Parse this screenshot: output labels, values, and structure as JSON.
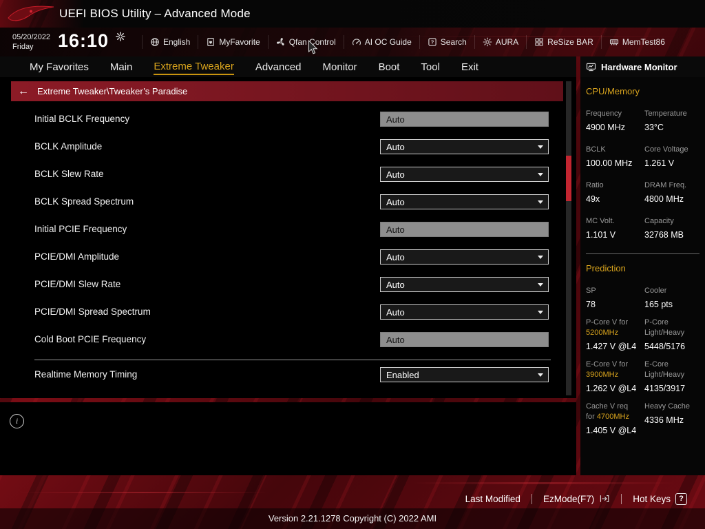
{
  "header": {
    "title": "UEFI BIOS Utility – Advanced Mode",
    "date": "05/20/2022",
    "day": "Friday",
    "time": "16:10",
    "toolbar": [
      {
        "icon": "globe-icon",
        "label": "English"
      },
      {
        "icon": "favorite-icon",
        "label": "MyFavorite"
      },
      {
        "icon": "fan-icon",
        "label": "Qfan Control"
      },
      {
        "icon": "gauge-icon",
        "label": "AI OC Guide"
      },
      {
        "icon": "question-icon",
        "label": "Search"
      },
      {
        "icon": "aura-icon",
        "label": "AURA"
      },
      {
        "icon": "grid-icon",
        "label": "ReSize BAR"
      },
      {
        "icon": "memory-icon",
        "label": "MemTest86"
      }
    ]
  },
  "menu": {
    "tabs": [
      "My Favorites",
      "Main",
      "Extreme Tweaker",
      "Advanced",
      "Monitor",
      "Boot",
      "Tool",
      "Exit"
    ],
    "active_tab": "Extreme Tweaker"
  },
  "breadcrumb": {
    "back_icon": "←",
    "path": "Extreme Tweaker\\Tweaker’s Paradise"
  },
  "settings": [
    {
      "label": "Initial BCLK Frequency",
      "value": "Auto",
      "control": "input"
    },
    {
      "label": "BCLK Amplitude",
      "value": "Auto",
      "control": "select"
    },
    {
      "label": "BCLK Slew Rate",
      "value": "Auto",
      "control": "select"
    },
    {
      "label": "BCLK Spread Spectrum",
      "value": "Auto",
      "control": "select"
    },
    {
      "label": "Initial PCIE Frequency",
      "value": "Auto",
      "control": "input"
    },
    {
      "label": "PCIE/DMI Amplitude",
      "value": "Auto",
      "control": "select"
    },
    {
      "label": "PCIE/DMI Slew Rate",
      "value": "Auto",
      "control": "select"
    },
    {
      "label": "PCIE/DMI Spread Spectrum",
      "value": "Auto",
      "control": "select"
    },
    {
      "label": "Cold Boot PCIE Frequency",
      "value": "Auto",
      "control": "input"
    },
    {
      "control": "divider"
    },
    {
      "label": "Realtime Memory Timing",
      "value": "Enabled",
      "control": "select"
    }
  ],
  "hardware_monitor": {
    "title": "Hardware Monitor",
    "sections": [
      {
        "title": "CPU/Memory",
        "divider_after": true,
        "cells": [
          {
            "lines": [
              "Frequency"
            ],
            "value": "4900 MHz"
          },
          {
            "lines": [
              "Temperature"
            ],
            "value": "33°C"
          },
          {
            "lines": [
              "BCLK"
            ],
            "value": "100.00 MHz"
          },
          {
            "lines": [
              "Core Voltage"
            ],
            "value": "1.261 V"
          },
          {
            "lines": [
              "Ratio"
            ],
            "value": "49x"
          },
          {
            "lines": [
              "DRAM Freq."
            ],
            "value": "4800 MHz"
          },
          {
            "lines": [
              "MC Volt."
            ],
            "value": "1.101 V"
          },
          {
            "lines": [
              "Capacity"
            ],
            "value": "32768 MB"
          }
        ]
      },
      {
        "title": "Prediction",
        "divider_after": false,
        "cells": [
          {
            "lines": [
              "SP"
            ],
            "value": "78"
          },
          {
            "lines": [
              "Cooler"
            ],
            "value": "165 pts"
          },
          {
            "lines": [
              "P-Core V for",
              {
                "accent": "5200MHz"
              }
            ],
            "value": "1.427 V @L4"
          },
          {
            "lines": [
              "P-Core",
              "Light/Heavy"
            ],
            "value": "5448/5176"
          },
          {
            "lines": [
              "E-Core V for",
              {
                "accent": "3900MHz"
              }
            ],
            "value": "1.262 V @L4"
          },
          {
            "lines": [
              "E-Core",
              "Light/Heavy"
            ],
            "value": "4135/3917"
          },
          {
            "lines": [
              "Cache V req",
              {
                "pre": "for ",
                "accent": "4700MHz"
              }
            ],
            "value": "1.405 V @L4"
          },
          {
            "lines": [
              "Heavy Cache"
            ],
            "value": "4336 MHz"
          }
        ]
      }
    ]
  },
  "help": {
    "info_icon": "i"
  },
  "footer": {
    "last_modified": "Last Modified",
    "ezmode": "EzMode(F7)",
    "hot_keys": "Hot Keys",
    "hot_keys_icon": "?",
    "version": "Version 2.21.1278 Copyright (C) 2022 AMI"
  },
  "colors": {
    "accent_yellow": "#d9a41d",
    "rog_red": "#c22530",
    "breadcrumb_red": "#8c1b26"
  }
}
